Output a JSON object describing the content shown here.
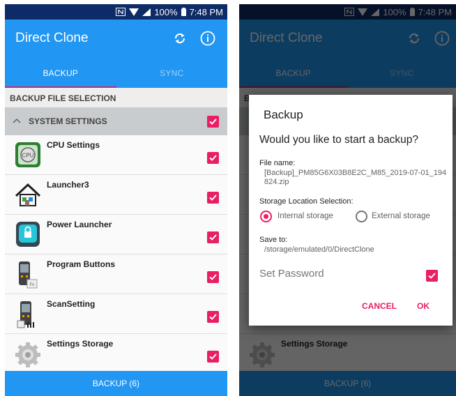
{
  "status": {
    "battery": "100%",
    "time": "7:48 PM"
  },
  "app": {
    "title": "Direct Clone",
    "sync_icon": "sync-icon",
    "info_icon": "info-icon"
  },
  "tabs": [
    {
      "label": "BACKUP",
      "active": true
    },
    {
      "label": "SYNC",
      "active": false
    }
  ],
  "section_title": "BACKUP FILE SELECTION",
  "group": {
    "label": "SYSTEM SETTINGS",
    "checked": true
  },
  "apps": [
    {
      "name": "CPU Settings",
      "icon": "cpu-settings-icon",
      "checked": true
    },
    {
      "name": "Launcher3",
      "icon": "launcher-home-icon",
      "checked": true
    },
    {
      "name": "Power Launcher",
      "icon": "power-launcher-icon",
      "checked": true
    },
    {
      "name": "Program Buttons",
      "icon": "program-buttons-icon",
      "checked": true
    },
    {
      "name": "ScanSetting",
      "icon": "scan-setting-icon",
      "checked": true
    },
    {
      "name": "Settings Storage",
      "icon": "settings-gear-icon",
      "checked": true
    }
  ],
  "bottom_button": "BACKUP (6)",
  "dialog": {
    "title": "Backup",
    "question": "Would you like to start a backup?",
    "file_name_label": "File name:",
    "file_name": "[Backup]_PM85G6X03B8E2C_M85_2019-07-01_194824.zip",
    "storage_label": "Storage Location Selection:",
    "storage_options": [
      {
        "label": "Internal storage",
        "selected": true
      },
      {
        "label": "External storage",
        "selected": false
      }
    ],
    "save_to_label": "Save to:",
    "save_to": "/storage/emulated/0/DirectClone",
    "password_label": "Set Password",
    "password_checked": true,
    "cancel": "CANCEL",
    "ok": "OK"
  },
  "colors": {
    "primary": "#2196f3",
    "accent": "#e91e63",
    "status_bar": "#0d2b66"
  }
}
